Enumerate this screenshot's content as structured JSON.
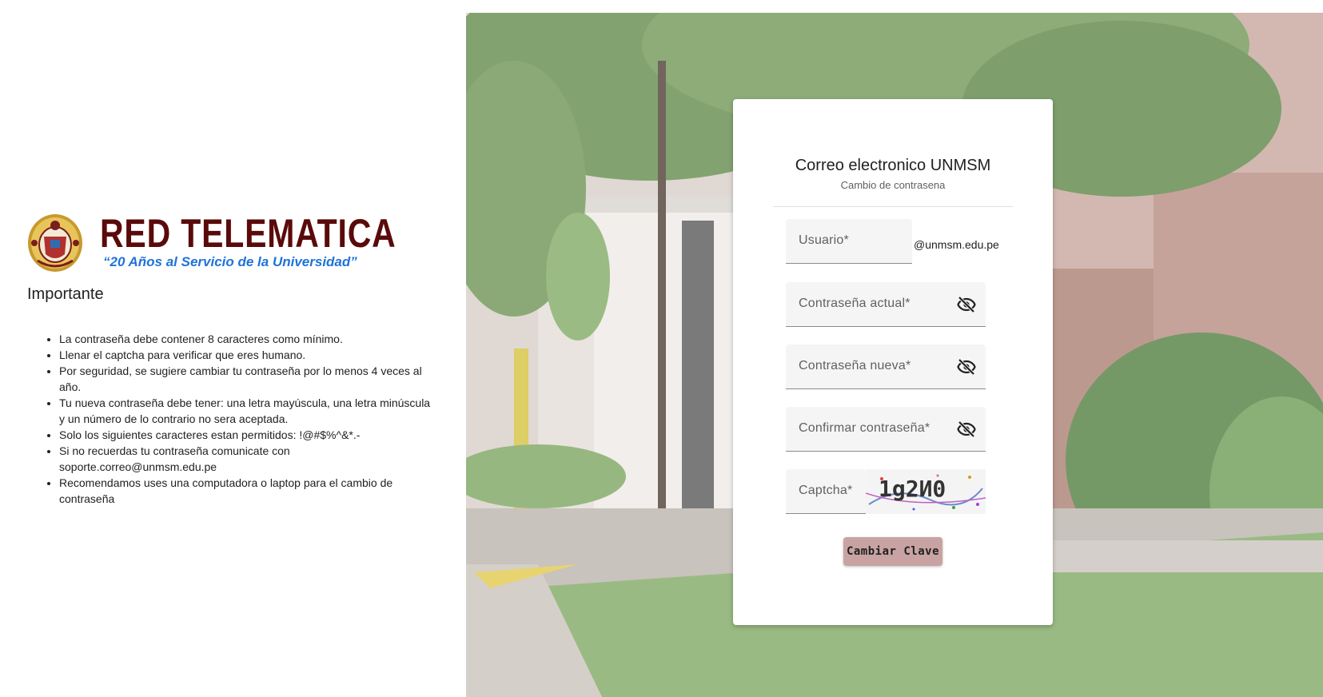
{
  "brand": {
    "title": "RED TELEMATICA",
    "slogan": "“20 Años al Servicio de la Universidad”"
  },
  "important": {
    "title": "Importante",
    "items": [
      "La contraseña debe contener 8 caracteres como mínimo.",
      "Llenar el captcha para verificar que eres humano.",
      "Por seguridad, se sugiere cambiar tu contraseña por lo menos 4 veces al año.",
      "Tu nueva contraseña debe tener: una letra mayúscula, una letra minúscula y un número de lo contrario no sera aceptada.",
      "Solo los siguientes caracteres estan permitidos: !@#$%^&*.-",
      "Si no recuerdas tu contraseña comunicate con soporte.correo@unmsm.edu.pe",
      "Recomendamos uses una computadora o laptop para el cambio de contraseña"
    ]
  },
  "card": {
    "title": "Correo electronico UNMSM",
    "subtitle": "Cambio de contrasena",
    "domain_suffix": "@unmsm.edu.pe",
    "fields": {
      "user": "Usuario*",
      "current": "Contraseña actual*",
      "new": "Contraseña nueva*",
      "confirm": "Confirmar contraseña*",
      "captcha": "Captcha*"
    },
    "captcha_text": "1g2И0",
    "submit_label": "Cambiar Clave",
    "eye_icon": "eye-off-icon"
  },
  "colors": {
    "brand_title": "#5a0a0a",
    "slogan": "#1e73d8",
    "button": "#c9a3a3"
  }
}
